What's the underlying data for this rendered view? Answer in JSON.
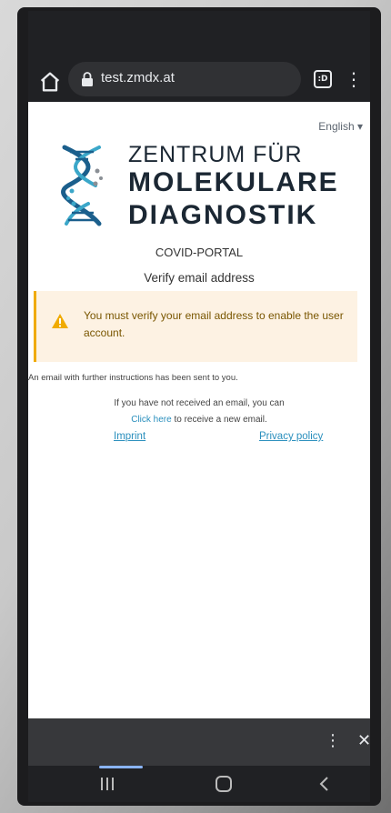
{
  "browser": {
    "url": "test.zmdx.at",
    "tabs_count": ":D"
  },
  "page": {
    "language": "English",
    "logo": {
      "line1": "ZENTRUM FÜR",
      "line2": "MOLEKULARE",
      "line3": "DIAGNOSTIK"
    },
    "portal_name": "COVID-PORTAL",
    "title": "Verify email address",
    "alert_text": "You must verify your email address to enable the user account.",
    "info_text": "An email with further instructions has been sent to you.",
    "hint_text": "If you have not received an email, you can",
    "click_here": "Click here",
    "hint_suffix": " to receive a new email.",
    "imprint": "Imprint",
    "privacy": "Privacy policy"
  },
  "colors": {
    "link": "#2a8fbd",
    "warning": "#f0ab00",
    "alert_bg": "#fdf2e3",
    "alert_text": "#795600"
  }
}
